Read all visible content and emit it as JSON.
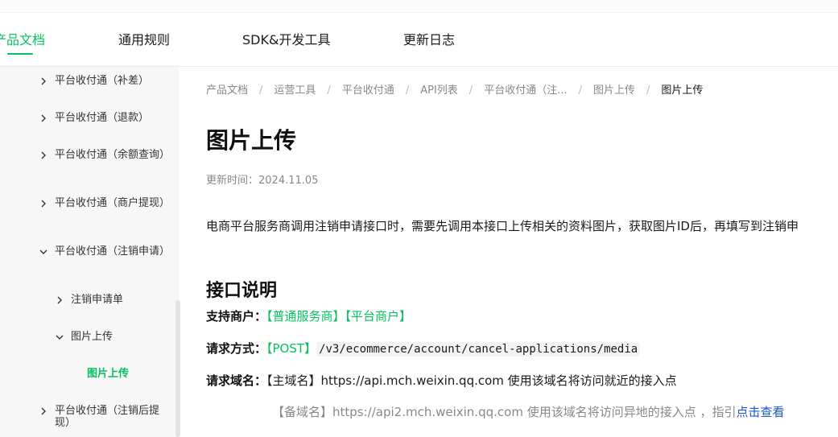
{
  "header": {
    "tabs": [
      {
        "label": "产品文档",
        "active": true
      },
      {
        "label": "通用规则",
        "active": false
      },
      {
        "label": "SDK&开发工具",
        "active": false
      },
      {
        "label": "更新日志",
        "active": false
      }
    ]
  },
  "sidebar": {
    "items": [
      {
        "label": "平台收付通（补差）",
        "expanded": false
      },
      {
        "label": "平台收付通（退款）",
        "expanded": false
      },
      {
        "label": "平台收付通（余额查询）",
        "expanded": false
      },
      {
        "label": "平台收付通（商户提现）",
        "expanded": false
      },
      {
        "label": "平台收付通（注销申请）",
        "expanded": true
      },
      {
        "label": "注销申请单",
        "expanded": false
      },
      {
        "label": "图片上传",
        "expanded": true
      },
      {
        "label": "图片上传",
        "selected": true
      },
      {
        "label": "平台收付通（注销后提现）",
        "expanded": false
      }
    ]
  },
  "breadcrumb": [
    "产品文档",
    "运营工具",
    "平台收付通",
    "API列表",
    "平台收付通（注...",
    "图片上传",
    "图片上传"
  ],
  "page": {
    "title": "图片上传",
    "updated": "更新时间：2024.11.05",
    "intro": "电商平台服务商调用注销申请接口时，需要先调用本接口上传相关的资料图片，获取图片ID后，再填写到注销申",
    "section_title": "接口说明",
    "support_label": "支持商户：",
    "support_values": [
      "【普通服务商】",
      "【平台商户】"
    ],
    "method_label": "请求方式：",
    "method": "【POST】",
    "path": "/v3/ecommerce/account/cancel-applications/media",
    "domain_label": "请求域名：",
    "primary_domain": "【主域名】https://api.mch.weixin.qq.com 使用该域名将访问就近的接入点",
    "backup_domain": "【备域名】https://api2.mch.weixin.qq.com 使用该域名将访问异地的接入点 ，指引",
    "backup_link": "点击查看"
  },
  "colors": {
    "accent": "#07c160",
    "link": "#1a56c8"
  }
}
